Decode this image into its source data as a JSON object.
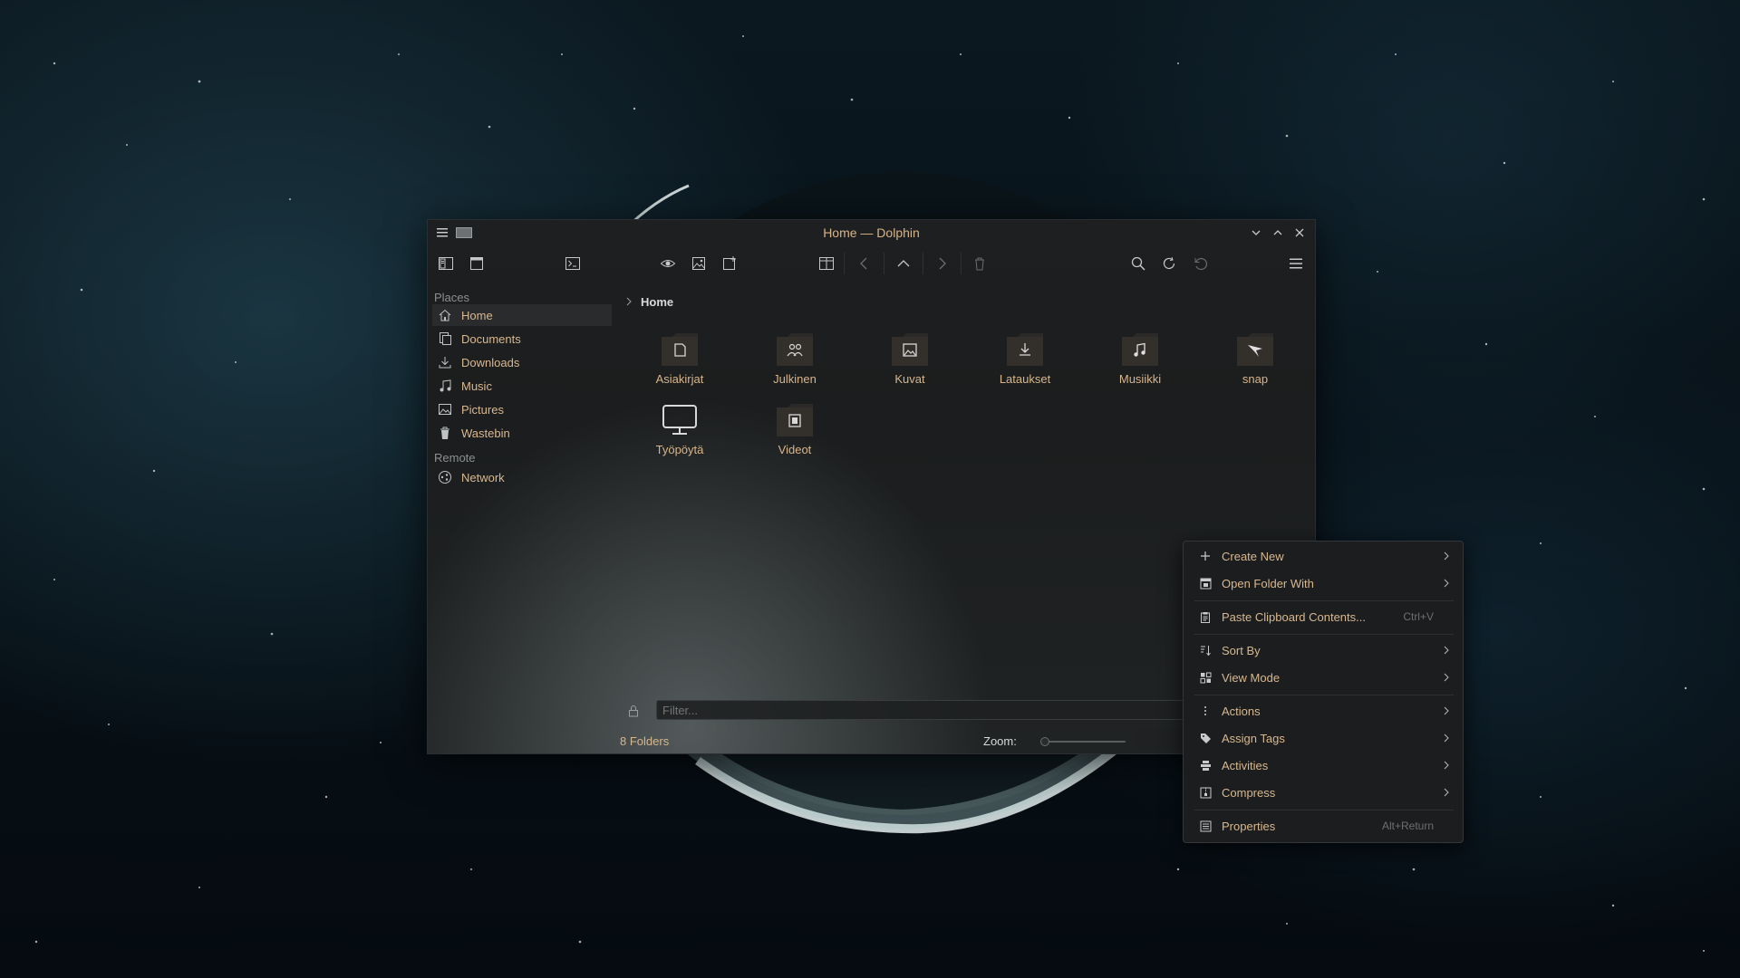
{
  "window": {
    "title": "Home — Dolphin"
  },
  "sidebar": {
    "places_heading": "Places",
    "remote_heading": "Remote",
    "items": [
      {
        "label": "Home",
        "icon": "home-icon"
      },
      {
        "label": "Documents",
        "icon": "documents-icon"
      },
      {
        "label": "Downloads",
        "icon": "download-icon"
      },
      {
        "label": "Music",
        "icon": "music-icon"
      },
      {
        "label": "Pictures",
        "icon": "pictures-icon"
      },
      {
        "label": "Wastebin",
        "icon": "trash-icon"
      }
    ],
    "remote_items": [
      {
        "label": "Network",
        "icon": "network-icon"
      }
    ]
  },
  "breadcrumb": {
    "current": "Home"
  },
  "folders": [
    {
      "label": "Asiakirjat",
      "icon": "document-folder-icon"
    },
    {
      "label": "Julkinen",
      "icon": "public-folder-icon"
    },
    {
      "label": "Kuvat",
      "icon": "pictures-folder-icon"
    },
    {
      "label": "Lataukset",
      "icon": "downloads-folder-icon"
    },
    {
      "label": "Musiikki",
      "icon": "music-folder-icon"
    },
    {
      "label": "snap",
      "icon": "snap-folder-icon"
    },
    {
      "label": "Työpöytä",
      "icon": "desktop-icon"
    },
    {
      "label": "Videot",
      "icon": "videos-folder-icon"
    }
  ],
  "filter": {
    "placeholder": "Filter..."
  },
  "status": {
    "summary": "8 Folders",
    "zoom_label": "Zoom:"
  },
  "context_menu": {
    "items": [
      {
        "label": "Create New",
        "icon": "plus-icon",
        "submenu": true
      },
      {
        "label": "Open Folder With",
        "icon": "open-with-icon",
        "submenu": true
      },
      {
        "label": "Paste Clipboard Contents...",
        "icon": "clipboard-icon",
        "shortcut": "Ctrl+V"
      },
      {
        "label": "Sort By",
        "icon": "sort-icon",
        "submenu": true
      },
      {
        "label": "View Mode",
        "icon": "view-mode-icon",
        "submenu": true
      },
      {
        "label": "Actions",
        "icon": "more-vertical-icon",
        "submenu": true
      },
      {
        "label": "Assign Tags",
        "icon": "tag-icon",
        "submenu": true
      },
      {
        "label": "Activities",
        "icon": "activities-icon",
        "submenu": true
      },
      {
        "label": "Compress",
        "icon": "compress-icon",
        "submenu": true
      },
      {
        "label": "Properties",
        "icon": "properties-icon",
        "shortcut": "Alt+Return"
      }
    ]
  },
  "colors": {
    "accent_text": "#d8b68b",
    "window_bg": "#1d1f20",
    "menu_bg": "#1b1d1e"
  }
}
